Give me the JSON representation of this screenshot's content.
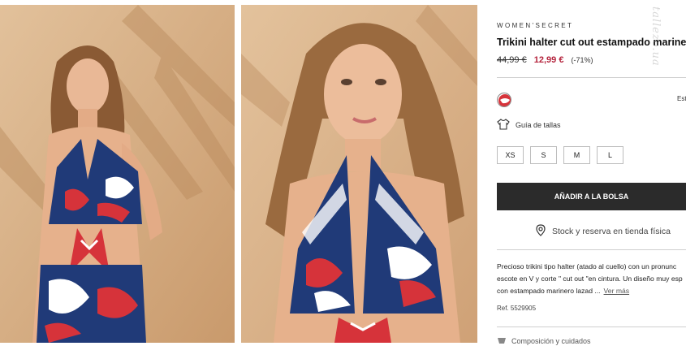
{
  "product": {
    "brand": "WOMEN'SECRET",
    "title": "Trikini halter cut out estampado marinero",
    "old_price": "44,99 €",
    "new_price": "12,99 €",
    "discount": "(-71%)"
  },
  "color": {
    "label": "Est",
    "swatch_colors": [
      "#d6333a",
      "#ffffff"
    ]
  },
  "size_guide": {
    "label": "Guía de tallas",
    "icon": "shirt-icon"
  },
  "sizes": [
    "XS",
    "S",
    "M",
    "L"
  ],
  "add_to_bag": "AÑADIR A LA BOLSA",
  "stock": {
    "label": "Stock y reserva en tienda física",
    "icon": "location-pin-icon"
  },
  "description": {
    "line1": "Precioso trikini tipo halter (atado al cuello) con un pronunc",
    "line2": "escote en V y corte \" cut out \"en cintura. Un diseño muy esp",
    "line3": "con estampado marinero lazad ...",
    "more": "Ver más"
  },
  "ref": "Ref. 5529905",
  "composition": {
    "label": "Composición y cuidados",
    "icon": "care-icon"
  },
  "watermark": "tallezo.ua",
  "colors": {
    "accent_price": "#b4233c",
    "button_bg": "#2b2b2b",
    "photo_backdrop": "#d9b38a"
  }
}
